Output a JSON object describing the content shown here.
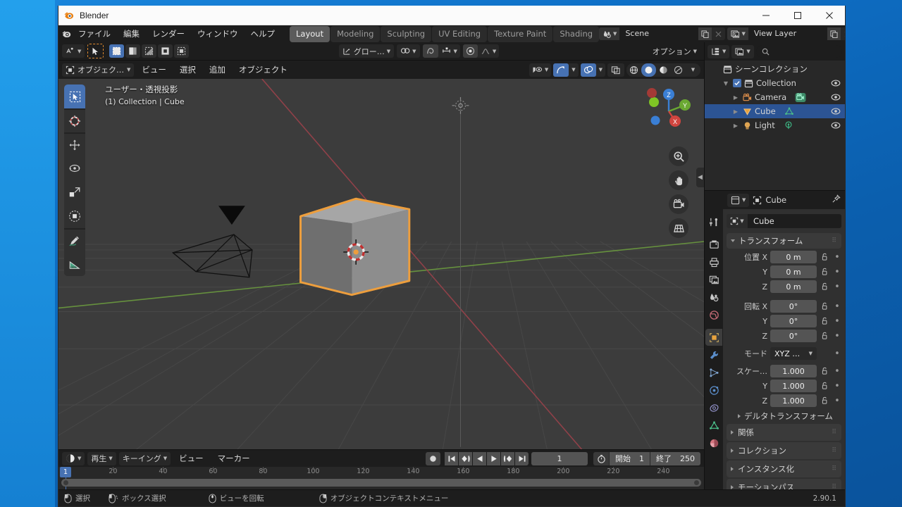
{
  "window": {
    "title": "Blender",
    "minimize": "–",
    "maximize": "□",
    "close": "×"
  },
  "topbar": {
    "menus": [
      "ファイル",
      "編集",
      "レンダー",
      "ウィンドウ",
      "ヘルプ"
    ],
    "workspaces": [
      {
        "label": "Layout",
        "active": true
      },
      {
        "label": "Modeling",
        "active": false
      },
      {
        "label": "Sculpting",
        "active": false
      },
      {
        "label": "UV Editing",
        "active": false
      },
      {
        "label": "Texture Paint",
        "active": false
      },
      {
        "label": "Shading",
        "active": false
      }
    ],
    "scene": {
      "name": "Scene",
      "icon": "scene-icon"
    },
    "view_layer": {
      "name": "View Layer",
      "icon": "view-layer-icon"
    }
  },
  "viewport_header": {
    "transform_orientation": "グロー…",
    "options_label": "オプション",
    "mode": "オブジェク…",
    "menus": [
      "ビュー",
      "選択",
      "追加",
      "オブジェクト"
    ]
  },
  "viewport": {
    "overlay_line1": "ユーザー・透視投影",
    "overlay_line2": "(1) Collection | Cube",
    "gizmo_axes": [
      "X",
      "Y",
      "Z"
    ],
    "tools": [
      "select-box-tool",
      "cursor-tool",
      "move-tool",
      "rotate-tool",
      "scale-tool",
      "transform-tool",
      "annotate-tool",
      "measure-tool"
    ],
    "nav_buttons": [
      "zoom-icon",
      "pan-icon",
      "camera-icon",
      "grid-icon"
    ],
    "colors": {
      "background": "#3c3c3c",
      "grid": "#4b4b4b",
      "x_axis": "#99414a",
      "y_axis": "#6a9a3e",
      "selection_outline": "#ed9e3d",
      "cube_fill": "#999999"
    }
  },
  "outliner": {
    "rows": [
      {
        "label": "シーンコレクション",
        "icon": "collection-icon",
        "indent": 0,
        "selected": false,
        "eye": false,
        "checkbox": false,
        "disclosure": ""
      },
      {
        "label": "Collection",
        "icon": "collection-icon",
        "indent": 1,
        "selected": false,
        "eye": true,
        "checkbox": true,
        "disclosure": "▼"
      },
      {
        "label": "Camera",
        "icon": "camera-icon",
        "indent": 2,
        "selected": false,
        "eye": true,
        "checkbox": false,
        "disclosure": "▶",
        "data_icon": "camera-data-icon"
      },
      {
        "label": "Cube",
        "icon": "mesh-icon",
        "indent": 2,
        "selected": true,
        "eye": true,
        "checkbox": false,
        "disclosure": "▶",
        "data_icon": "mesh-data-icon"
      },
      {
        "label": "Light",
        "icon": "light-icon",
        "indent": 2,
        "selected": false,
        "eye": true,
        "checkbox": false,
        "disclosure": "▶",
        "data_icon": "light-data-icon"
      }
    ]
  },
  "properties": {
    "breadcrumb_object": "Cube",
    "name_value": "Cube",
    "transform_title": "トランスフォーム",
    "rows": [
      {
        "label": "位置 X",
        "value": "0 m"
      },
      {
        "label": "Y",
        "value": "0 m"
      },
      {
        "label": "Z",
        "value": "0 m"
      }
    ],
    "rotation_rows": [
      {
        "label": "回転 X",
        "value": "0°"
      },
      {
        "label": "Y",
        "value": "0°"
      },
      {
        "label": "Z",
        "value": "0°"
      }
    ],
    "mode_label": "モード",
    "mode_value": "XYZ …",
    "scale_rows": [
      {
        "label": "スケー…",
        "value": "1.000"
      },
      {
        "label": "Y",
        "value": "1.000"
      },
      {
        "label": "Z",
        "value": "1.000"
      }
    ],
    "delta_transform": "デルタトランスフォーム",
    "closed_panels": [
      "関係",
      "コレクション",
      "インスタンス化",
      "モーションパス"
    ],
    "tabs": [
      "tool-icon",
      "render-icon",
      "output-icon",
      "view-layer-icon",
      "scene-icon",
      "world-icon",
      "object-icon",
      "modifier-icon",
      "particles-icon",
      "physics-icon",
      "constraint-icon",
      "object-data-icon",
      "material-icon"
    ],
    "active_tab": "object-icon"
  },
  "timeline": {
    "menus": [
      "再生",
      "キーイング",
      "ビュー",
      "マーカー"
    ],
    "current_frame": "1",
    "start_label": "開始",
    "start_value": "1",
    "end_label": "終了",
    "end_value": "250",
    "ticks": [
      "20",
      "40",
      "60",
      "80",
      "100",
      "120",
      "140",
      "160",
      "180",
      "200",
      "220",
      "240"
    ],
    "tick_values": [
      20,
      40,
      60,
      80,
      100,
      120,
      140,
      160,
      180,
      200,
      220,
      240
    ],
    "playhead_frame": "1"
  },
  "statusbar": {
    "hints": [
      {
        "icon": "mouse-left-icon",
        "label": "選択"
      },
      {
        "icon": "mouse-drag-icon",
        "label": "ボックス選択"
      },
      {
        "icon": "mouse-middle-icon",
        "label": "ビューを回転"
      },
      {
        "icon": "mouse-right-icon",
        "label": "オブジェクトコンテキストメニュー"
      }
    ],
    "version": "2.90.1"
  }
}
